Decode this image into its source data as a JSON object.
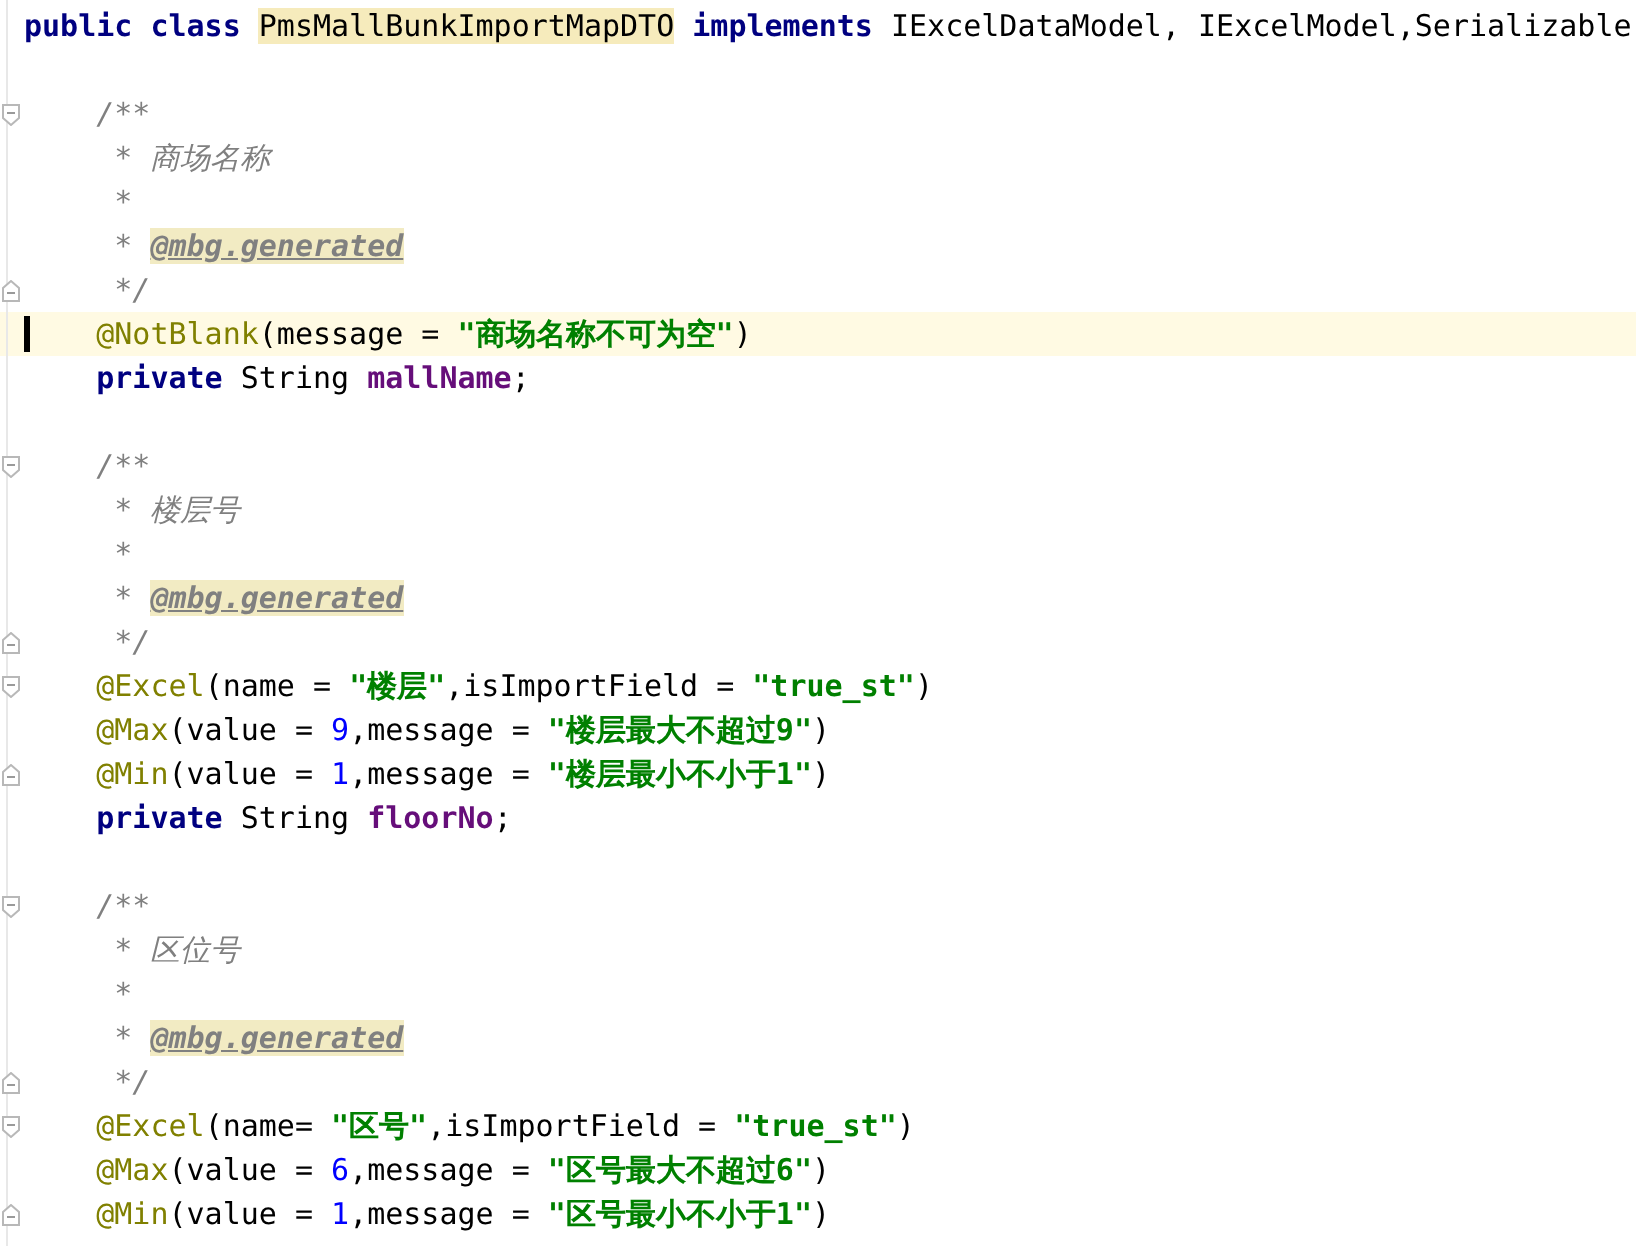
{
  "editor": {
    "lines": [
      {
        "fold_start": false,
        "fold_end": false,
        "current": false,
        "tokens": [
          {
            "kind": "keyword",
            "text": "public class "
          },
          {
            "kind": "classname",
            "text": "PmsMallBunkImportMapDTO"
          },
          {
            "kind": "keyword",
            "text": " implements"
          },
          {
            "kind": "plain",
            "text": " IExcelDataModel, IExcelModel,Serializable"
          }
        ]
      },
      {
        "fold_start": false,
        "fold_end": false,
        "current": false
      },
      {
        "fold_start": true,
        "fold_end": false,
        "current": false,
        "tokens": [
          {
            "kind": "comment",
            "text": "    /**"
          }
        ]
      },
      {
        "fold_start": false,
        "fold_end": false,
        "current": false,
        "tokens": [
          {
            "kind": "comment",
            "text": "     * 商场名称"
          }
        ]
      },
      {
        "fold_start": false,
        "fold_end": false,
        "current": false,
        "tokens": [
          {
            "kind": "comment",
            "text": "     *"
          }
        ]
      },
      {
        "fold_start": false,
        "fold_end": false,
        "current": false,
        "tokens": [
          {
            "kind": "comment",
            "text": "     * "
          },
          {
            "kind": "doctag",
            "text": "@mbg.generated"
          }
        ]
      },
      {
        "fold_start": false,
        "fold_end": true,
        "current": false,
        "tokens": [
          {
            "kind": "comment",
            "text": "     */"
          }
        ]
      },
      {
        "fold_start": false,
        "fold_end": false,
        "current": true,
        "tokens": [
          {
            "kind": "annotation",
            "text": "    @NotBlank"
          },
          {
            "kind": "plain",
            "text": "(message = "
          },
          {
            "kind": "string",
            "text": "\"商场名称不可为空\""
          },
          {
            "kind": "plain",
            "text": ")"
          }
        ]
      },
      {
        "fold_start": false,
        "fold_end": false,
        "current": false,
        "tokens": [
          {
            "kind": "keyword",
            "text": "    private"
          },
          {
            "kind": "plain",
            "text": " String "
          },
          {
            "kind": "field",
            "text": "mallName"
          },
          {
            "kind": "plain",
            "text": ";"
          }
        ]
      },
      {
        "fold_start": false,
        "fold_end": false,
        "current": false
      },
      {
        "fold_start": true,
        "fold_end": false,
        "current": false,
        "tokens": [
          {
            "kind": "comment",
            "text": "    /**"
          }
        ]
      },
      {
        "fold_start": false,
        "fold_end": false,
        "current": false,
        "tokens": [
          {
            "kind": "comment",
            "text": "     * 楼层号"
          }
        ]
      },
      {
        "fold_start": false,
        "fold_end": false,
        "current": false,
        "tokens": [
          {
            "kind": "comment",
            "text": "     *"
          }
        ]
      },
      {
        "fold_start": false,
        "fold_end": false,
        "current": false,
        "tokens": [
          {
            "kind": "comment",
            "text": "     * "
          },
          {
            "kind": "doctag",
            "text": "@mbg.generated"
          }
        ]
      },
      {
        "fold_start": false,
        "fold_end": true,
        "current": false,
        "tokens": [
          {
            "kind": "comment",
            "text": "     */"
          }
        ]
      },
      {
        "fold_start": true,
        "fold_end": false,
        "current": false,
        "tokens": [
          {
            "kind": "annotation",
            "text": "    @Excel"
          },
          {
            "kind": "plain",
            "text": "(name = "
          },
          {
            "kind": "string",
            "text": "\"楼层\""
          },
          {
            "kind": "plain",
            "text": ",isImportField = "
          },
          {
            "kind": "string",
            "text": "\"true_st\""
          },
          {
            "kind": "plain",
            "text": ")"
          }
        ]
      },
      {
        "fold_start": false,
        "fold_end": false,
        "current": false,
        "tokens": [
          {
            "kind": "annotation",
            "text": "    @Max"
          },
          {
            "kind": "plain",
            "text": "(value = "
          },
          {
            "kind": "number",
            "text": "9"
          },
          {
            "kind": "plain",
            "text": ",message = "
          },
          {
            "kind": "string",
            "text": "\"楼层最大不超过9\""
          },
          {
            "kind": "plain",
            "text": ")"
          }
        ]
      },
      {
        "fold_start": false,
        "fold_end": true,
        "current": false,
        "tokens": [
          {
            "kind": "annotation",
            "text": "    @Min"
          },
          {
            "kind": "plain",
            "text": "(value = "
          },
          {
            "kind": "number",
            "text": "1"
          },
          {
            "kind": "plain",
            "text": ",message = "
          },
          {
            "kind": "string",
            "text": "\"楼层最小不小于1\""
          },
          {
            "kind": "plain",
            "text": ")"
          }
        ]
      },
      {
        "fold_start": false,
        "fold_end": false,
        "current": false,
        "tokens": [
          {
            "kind": "keyword",
            "text": "    private"
          },
          {
            "kind": "plain",
            "text": " String "
          },
          {
            "kind": "field",
            "text": "floorNo"
          },
          {
            "kind": "plain",
            "text": ";"
          }
        ]
      },
      {
        "fold_start": false,
        "fold_end": false,
        "current": false
      },
      {
        "fold_start": true,
        "fold_end": false,
        "current": false,
        "tokens": [
          {
            "kind": "comment",
            "text": "    /**"
          }
        ]
      },
      {
        "fold_start": false,
        "fold_end": false,
        "current": false,
        "tokens": [
          {
            "kind": "comment",
            "text": "     * 区位号"
          }
        ]
      },
      {
        "fold_start": false,
        "fold_end": false,
        "current": false,
        "tokens": [
          {
            "kind": "comment",
            "text": "     *"
          }
        ]
      },
      {
        "fold_start": false,
        "fold_end": false,
        "current": false,
        "tokens": [
          {
            "kind": "comment",
            "text": "     * "
          },
          {
            "kind": "doctag",
            "text": "@mbg.generated"
          }
        ]
      },
      {
        "fold_start": false,
        "fold_end": true,
        "current": false,
        "tokens": [
          {
            "kind": "comment",
            "text": "     */"
          }
        ]
      },
      {
        "fold_start": true,
        "fold_end": false,
        "current": false,
        "tokens": [
          {
            "kind": "annotation",
            "text": "    @Excel"
          },
          {
            "kind": "plain",
            "text": "(name= "
          },
          {
            "kind": "string",
            "text": "\"区号\""
          },
          {
            "kind": "plain",
            "text": ",isImportField = "
          },
          {
            "kind": "string",
            "text": "\"true_st\""
          },
          {
            "kind": "plain",
            "text": ")"
          }
        ]
      },
      {
        "fold_start": false,
        "fold_end": false,
        "current": false,
        "tokens": [
          {
            "kind": "annotation",
            "text": "    @Max"
          },
          {
            "kind": "plain",
            "text": "(value = "
          },
          {
            "kind": "number",
            "text": "6"
          },
          {
            "kind": "plain",
            "text": ",message = "
          },
          {
            "kind": "string",
            "text": "\"区号最大不超过6\""
          },
          {
            "kind": "plain",
            "text": ")"
          }
        ]
      },
      {
        "fold_start": false,
        "fold_end": true,
        "current": false,
        "tokens": [
          {
            "kind": "annotation",
            "text": "    @Min"
          },
          {
            "kind": "plain",
            "text": "(value = "
          },
          {
            "kind": "number",
            "text": "1"
          },
          {
            "kind": "plain",
            "text": ",message = "
          },
          {
            "kind": "string",
            "text": "\"区号最小不小于1\""
          },
          {
            "kind": "plain",
            "text": ")"
          }
        ]
      }
    ]
  }
}
